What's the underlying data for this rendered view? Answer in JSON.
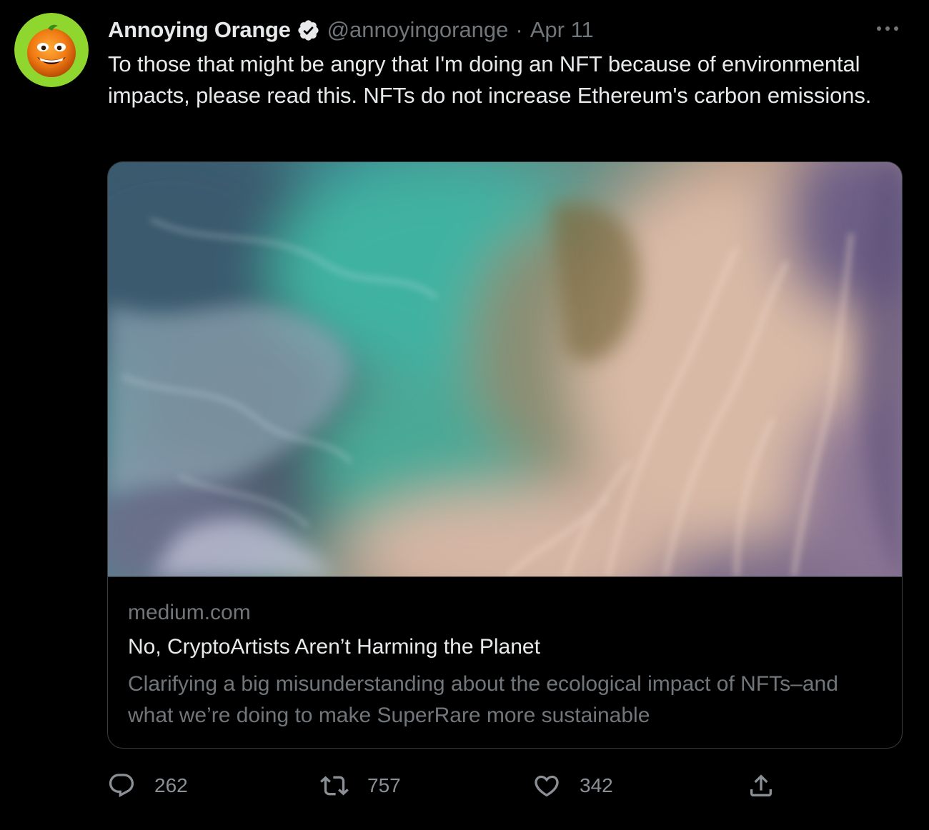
{
  "tweet": {
    "display_name": "Annoying Orange",
    "handle": "@annoyingorange",
    "separator": "·",
    "date": "Apr 11",
    "text": "To those that might be angry that I'm doing an NFT because of environmental impacts, please read this. NFTs do not increase Ethereum's carbon emissions.",
    "verified": true
  },
  "card": {
    "domain": "medium.com",
    "title": "No, CryptoArtists Aren’t Harming the Planet",
    "description": "Clarifying a big misunderstanding about the ecological impact of NFTs–and what we’re doing to make SuperRare more sustainable"
  },
  "actions": {
    "reply_count": "262",
    "retweet_count": "757",
    "like_count": "342"
  },
  "icons": {
    "avatar": "annoying-orange-avatar",
    "verified": "verified-badge-icon",
    "more": "more-icon",
    "reply": "reply-icon",
    "retweet": "retweet-icon",
    "like": "heart-icon",
    "share": "share-icon"
  },
  "colors": {
    "background": "#000000",
    "primary_text": "#e7e9ea",
    "secondary_text": "#71767b",
    "border": "#3a3d40",
    "avatar_ring": "#8fd62e"
  }
}
